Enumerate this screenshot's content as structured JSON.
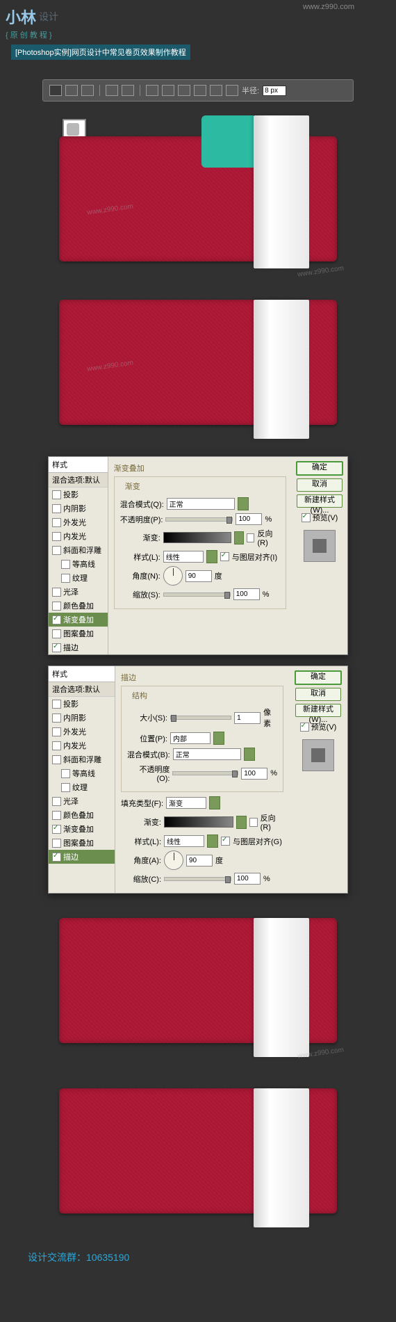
{
  "header": {
    "logo_main": "小林",
    "logo_sub": "设计",
    "tag": "{ 原 创 教 程 }",
    "url": "www.z990.com",
    "title": "[Photoshop实例]网页设计中常见卷页效果制作教程"
  },
  "toolbar": {
    "radius_label": "半径:",
    "radius_value": "8 px"
  },
  "wm": {
    "url": "www.z990.com",
    "name": "小林设计"
  },
  "styles_panel": {
    "header": "样式",
    "subheader": "混合选项:默认",
    "items": [
      "投影",
      "内阴影",
      "外发光",
      "内发光",
      "斜面和浮雕",
      "等高线",
      "纹理",
      "光泽",
      "颜色叠加",
      "渐变叠加",
      "图案叠加",
      "描边"
    ]
  },
  "dialog1": {
    "section_title": "渐变叠加",
    "group": "渐变",
    "blend_label": "混合模式(Q):",
    "blend_value": "正常",
    "opacity_label": "不透明度(P):",
    "opacity_value": "100",
    "opacity_unit": "%",
    "grad_label": "渐变:",
    "reverse_label": "反向(R)",
    "style_label": "样式(L):",
    "style_value": "线性",
    "align_label": "与图层对齐(I)",
    "angle_label": "角度(N):",
    "angle_value": "90",
    "angle_unit": "度",
    "scale_label": "缩放(S):",
    "scale_value": "100",
    "scale_unit": "%"
  },
  "dialog2": {
    "section_title": "描边",
    "group": "结构",
    "size_label": "大小(S):",
    "size_value": "1",
    "size_unit": "像素",
    "pos_label": "位置(P):",
    "pos_value": "内部",
    "blend_label": "混合模式(B):",
    "blend_value": "正常",
    "opacity_label": "不透明度(O):",
    "opacity_value": "100",
    "opacity_unit": "%",
    "fill_label": "填充类型(F):",
    "fill_value": "渐变",
    "grad_label": "渐变:",
    "reverse_label": "反向(R)",
    "style_label": "样式(L):",
    "style_value": "线性",
    "align_label": "与图层对齐(G)",
    "angle_label": "角度(A):",
    "angle_value": "90",
    "angle_unit": "度",
    "scale_label": "缩放(C):",
    "scale_value": "100",
    "scale_unit": "%"
  },
  "buttons": {
    "ok": "确定",
    "cancel": "取消",
    "new_style": "新建样式(W)...",
    "preview": "预览(V)"
  },
  "footer": {
    "text": "设计交流群：10635190"
  }
}
